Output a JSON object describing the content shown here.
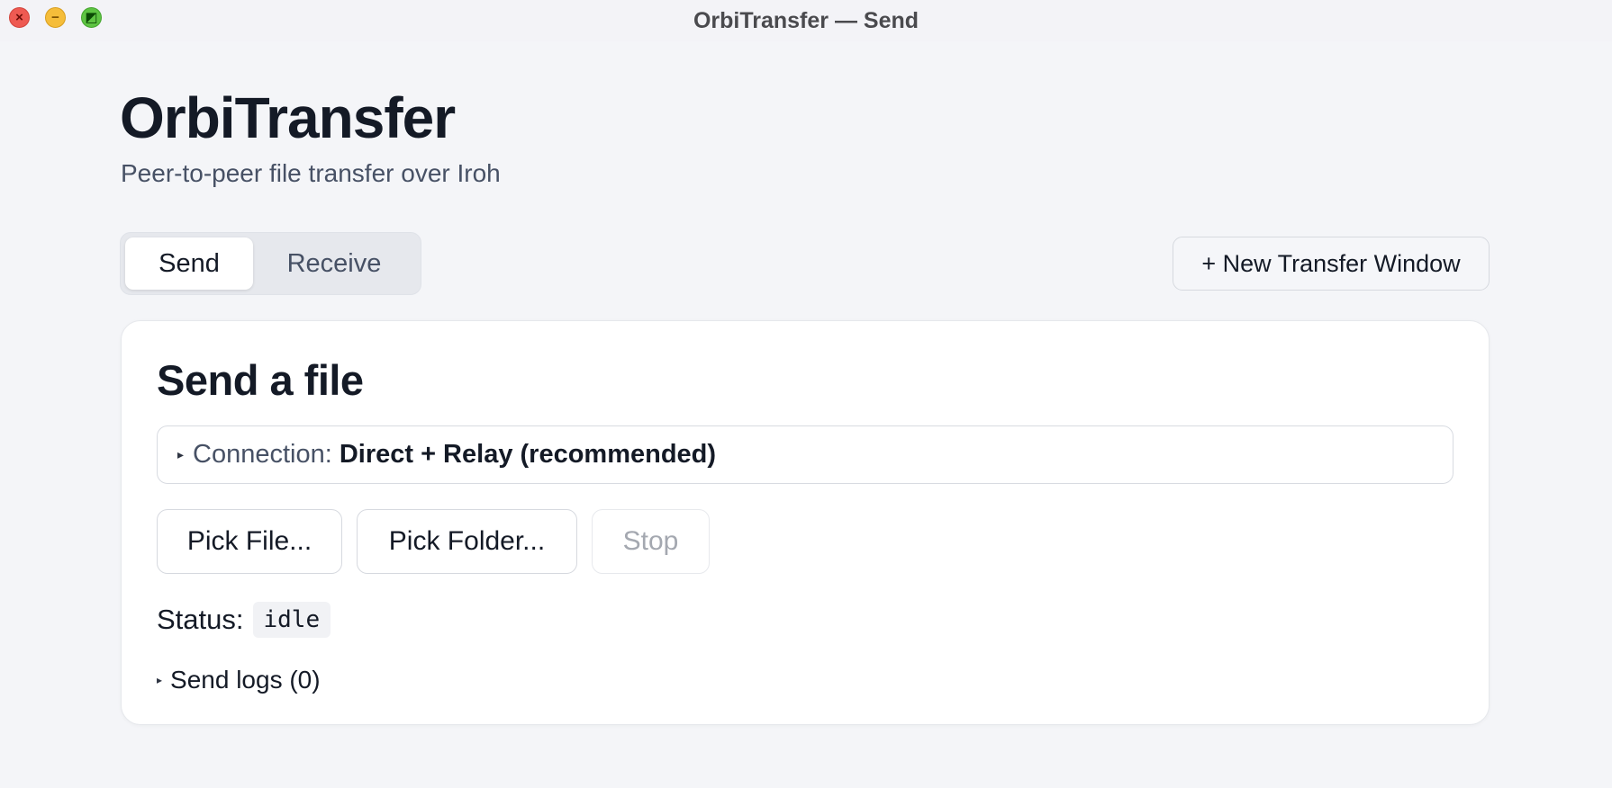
{
  "window": {
    "title": "OrbiTransfer — Send",
    "controls": {
      "close": "×",
      "minimize": "−",
      "maximize": "◩"
    }
  },
  "header": {
    "app_name": "OrbiTransfer",
    "subtitle": "Peer-to-peer file transfer over Iroh"
  },
  "tabs": [
    {
      "label": "Send",
      "active": true
    },
    {
      "label": "Receive",
      "active": false
    }
  ],
  "new_window_button": "+ New Transfer Window",
  "card": {
    "title": "Send a file",
    "connection": {
      "label": "Connection:",
      "value": "Direct + Relay (recommended)",
      "disclosure": "▸"
    },
    "buttons": {
      "pick_file": "Pick File...",
      "pick_folder": "Pick Folder...",
      "stop": "Stop"
    },
    "status": {
      "label": "Status:",
      "value": "idle"
    },
    "logs": {
      "label": "Send logs (0)",
      "disclosure": "▸"
    }
  }
}
